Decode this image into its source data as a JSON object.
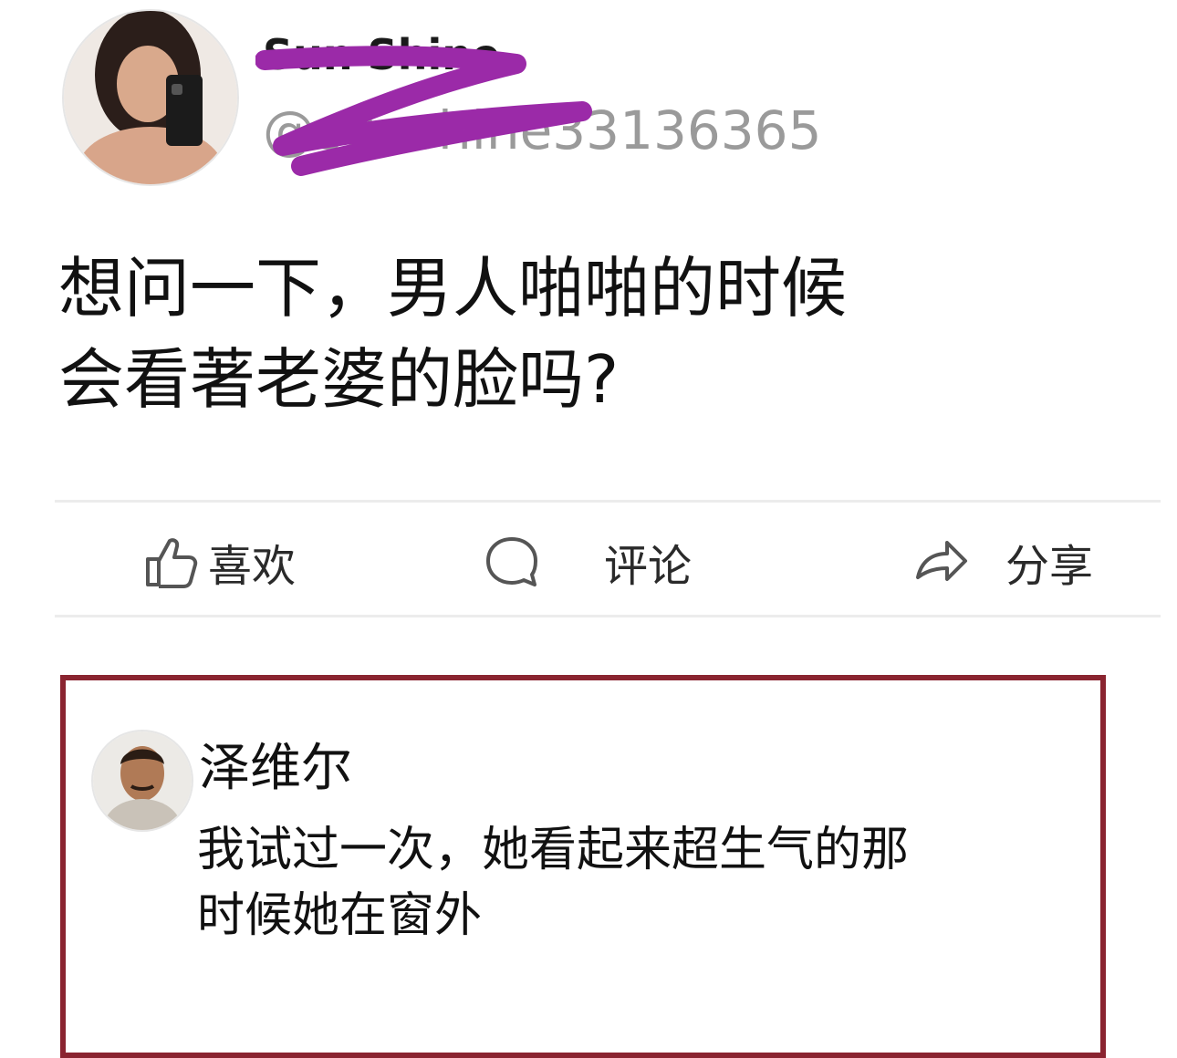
{
  "post": {
    "author": {
      "name": "Sun Shine",
      "handle": "@sunshine33136365"
    },
    "text_lines": [
      "想问一下，男人啪啪的时候",
      "会看著老婆的脸吗?"
    ]
  },
  "actions": {
    "like_label": "喜欢",
    "comment_label": "评论",
    "share_label": "分享"
  },
  "comment": {
    "author": "泽维尔",
    "text_lines": [
      "我试过一次，她看起来超生气的那",
      "时候她在窗外"
    ]
  },
  "colors": {
    "highlight_border": "#8a2430",
    "redaction_scribble": "#9b2aa8",
    "handle_gray": "#9a9a9a",
    "divider": "#ececec"
  },
  "icons": {
    "like": "thumbs-up-icon",
    "comment": "speech-bubble-icon",
    "share": "share-arrow-icon"
  }
}
